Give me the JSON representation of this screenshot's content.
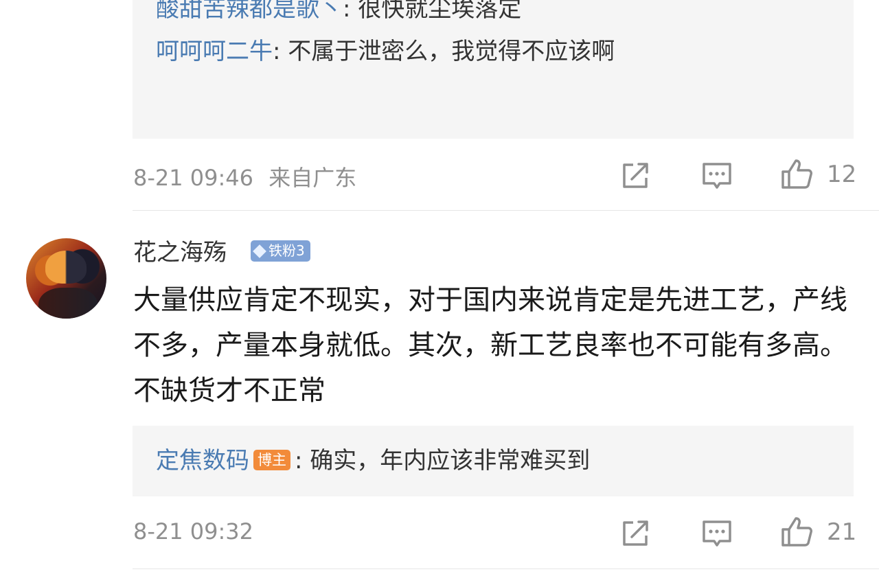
{
  "top_replies": [
    {
      "user": "酸甜苦辣都是歌丶",
      "text": "很快就尘埃落定"
    },
    {
      "user": "呵呵呵二牛",
      "text": "不属于泄密么，我觉得不应该啊"
    }
  ],
  "top_meta": {
    "timestamp": "8-21 09:46",
    "location": "来自广东",
    "like_count": "12"
  },
  "comment2": {
    "username": "花之海殇",
    "fan_badge": "铁粉3",
    "text": "大量供应肯定不现实，对于国内来说肯定是先进工艺，产线不多，产量本身就低。其次，新工艺良率也不可能有多高。不缺货才不正常",
    "reply": {
      "user": "定焦数码",
      "badge": "博主",
      "text": "确实，年内应该非常难买到"
    },
    "timestamp": "8-21 09:32",
    "like_count": "21"
  },
  "icons": {
    "repost": "repost-icon",
    "comment": "comment-icon",
    "like": "like-icon"
  },
  "colors": {
    "link": "#4a7bb2",
    "meta": "#8f8f8f",
    "fan_badge": "#7fa2d6",
    "blogger_badge": "#f28b3a"
  }
}
